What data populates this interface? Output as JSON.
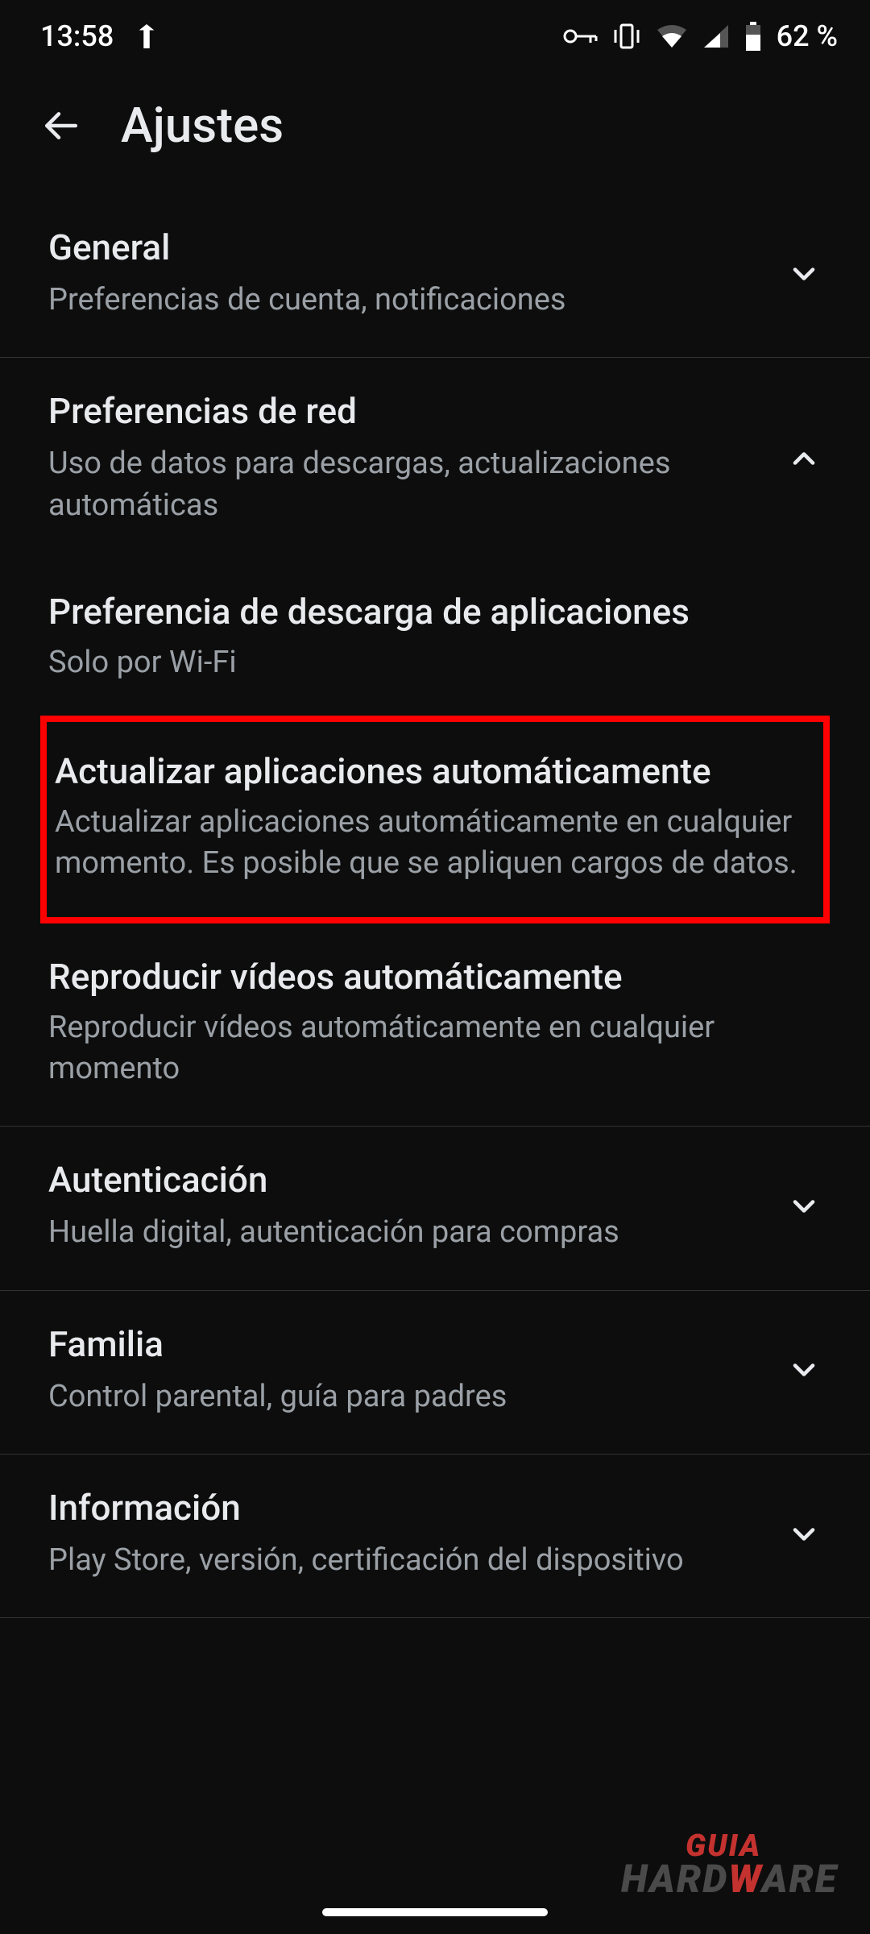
{
  "status_bar": {
    "time": "13:58",
    "battery_percent": "62 %"
  },
  "header": {
    "title": "Ajustes"
  },
  "sections": {
    "general": {
      "title": "General",
      "subtitle": "Preferencias de cuenta, notificaciones"
    },
    "network": {
      "title": "Preferencias de red",
      "subtitle": "Uso de datos para descargas, actualizaciones automáticas",
      "items": {
        "download_pref": {
          "title": "Preferencia de descarga de aplicaciones",
          "subtitle": "Solo por Wi-Fi"
        },
        "auto_update": {
          "title": "Actualizar aplicaciones automáticamente",
          "subtitle": "Actualizar aplicaciones automáticamente en cualquier momento. Es posible que se apliquen cargos de datos."
        },
        "autoplay": {
          "title": "Reproducir vídeos automáticamente",
          "subtitle": "Reproducir vídeos automáticamente en cualquier momento"
        }
      }
    },
    "auth": {
      "title": "Autenticación",
      "subtitle": "Huella digital, autenticación para compras"
    },
    "family": {
      "title": "Familia",
      "subtitle": "Control parental, guía para padres"
    },
    "info": {
      "title": "Información",
      "subtitle": "Play Store, versión, certificación del dispositivo"
    }
  },
  "watermark": {
    "line1": "GUIA",
    "line2_a": "HARD",
    "line2_b": "W",
    "line2_c": "ARE"
  }
}
